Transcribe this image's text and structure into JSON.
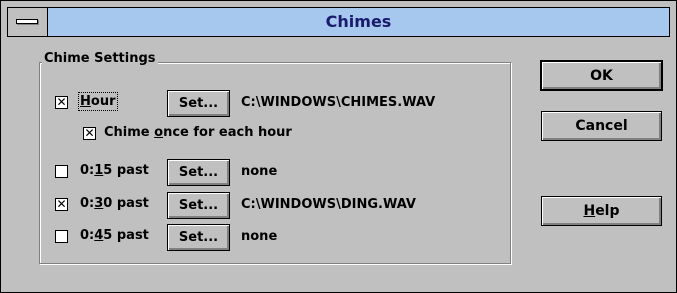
{
  "window": {
    "title": "Chimes"
  },
  "group": {
    "label": "Chime Settings",
    "hour": {
      "checked": true,
      "check_glyph": "✕",
      "label_pre": "",
      "label_key": "H",
      "label_post": "our",
      "set_label": "Set...",
      "file": "C:\\WINDOWS\\CHIMES.WAV",
      "each_hour": {
        "checked": true,
        "check_glyph": "✕",
        "label_pre": "Chime ",
        "label_key": "o",
        "label_post": "nce for each hour"
      }
    },
    "rows": [
      {
        "checked": false,
        "check_glyph": "",
        "label_pre": "0:",
        "label_key": "1",
        "label_post": "5 past",
        "set_label": "Set...",
        "file": "none"
      },
      {
        "checked": true,
        "check_glyph": "✕",
        "label_pre": "0:",
        "label_key": "3",
        "label_post": "0 past",
        "set_label": "Set...",
        "file": "C:\\WINDOWS\\DING.WAV"
      },
      {
        "checked": false,
        "check_glyph": "",
        "label_pre": "0:",
        "label_key": "4",
        "label_post": "5 past",
        "set_label": "Set...",
        "file": "none"
      }
    ]
  },
  "buttons": {
    "ok": "OK",
    "cancel": "Cancel",
    "help_pre": "",
    "help_key": "H",
    "help_post": "elp"
  },
  "colors": {
    "titlebar": "#a6c8ee",
    "title_text": "#1a1a6e",
    "face": "#c0c0c0"
  }
}
